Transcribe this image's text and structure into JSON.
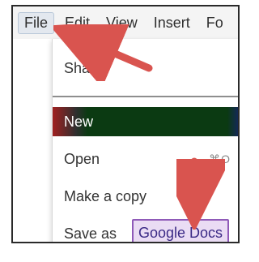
{
  "menubar": {
    "items": [
      {
        "label": "File",
        "active": true
      },
      {
        "label": "Edit"
      },
      {
        "label": "View"
      },
      {
        "label": "Insert"
      },
      {
        "label": "Fo"
      }
    ]
  },
  "dropdown": {
    "share": "Share",
    "new": "New",
    "open": "Open",
    "open_shortcut": "⌘O",
    "make_copy": "Make a copy",
    "save_as_prefix": "Save as",
    "save_as_target": "Google Docs"
  },
  "colors": {
    "arrow": "#d9544f",
    "docs_highlight_border": "#8f5ab8",
    "docs_highlight_bg": "#eadcf4"
  }
}
